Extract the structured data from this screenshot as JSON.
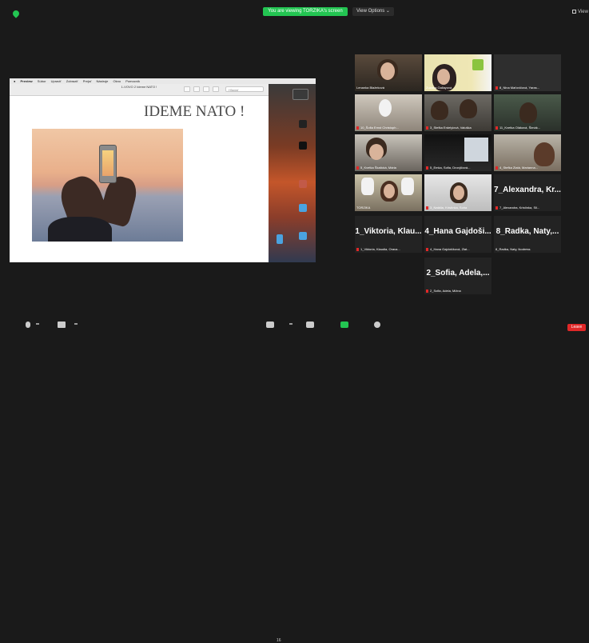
{
  "topbar": {
    "viewing_banner": "You are viewing TORZIKA's screen",
    "view_options": "View Options",
    "view_toggle": "View"
  },
  "share": {
    "mac_menu": [
      "Preview",
      "Súbor",
      "Upraviť",
      "Zobraziť",
      "Prejsť",
      "Nástroje",
      "Okno",
      "Pomocník"
    ],
    "window_title": "1-VOVO 2 Ideme NATO !",
    "search_placeholder": "Hľadať",
    "slide_title": "IDEME NATO !"
  },
  "gallery": {
    "video_tiles": [
      {
        "label": "Lenanka Blažeková"
      },
      {
        "label": "Zuzana Gallayová"
      },
      {
        "label": "8_Nina Maťovičová, Yaras..."
      },
      {
        "label": "10_Šofia Ernst Christoph..."
      },
      {
        "label": "3_Stefka Erdelyiová, Valuška"
      },
      {
        "label": "11_Kvetka Oláková, Šimák..."
      },
      {
        "label": "5_Kvetka Škalická, Mária"
      },
      {
        "label": "5_Emka, Sofia, Dronjičová..."
      },
      {
        "label": "4_Stefka Zlatá, Marianna..."
      },
      {
        "label": "TORZIKA"
      },
      {
        "label": "3_Natália, Kristínka, Soňa"
      }
    ],
    "name_tiles": [
      {
        "big": "7_Alexandra,  Kr...",
        "label": "7_Alexandra, Kristínka, Sil..."
      },
      {
        "big": "1_Viktoria,  Klau...",
        "label": "1_Viktoria, Klaudia, Orava..."
      },
      {
        "big": "4_Hana  Gajdoši...",
        "label": "4_Hana Gajdošíková, Zlat..."
      },
      {
        "big": "8_Radka,  Naty,...",
        "label": "8_Radka, Naty, Ikodress"
      },
      {
        "big": "2_Sofia,  Adela,...",
        "label": "2_Sofia, Adela, Mižna"
      }
    ]
  },
  "bottombar": {
    "participants_count": "16",
    "leave_label": "Leave"
  },
  "colors": {
    "accent_green": "#23c552",
    "leave_red": "#e02828",
    "active_speaker": "#d6e34a"
  }
}
